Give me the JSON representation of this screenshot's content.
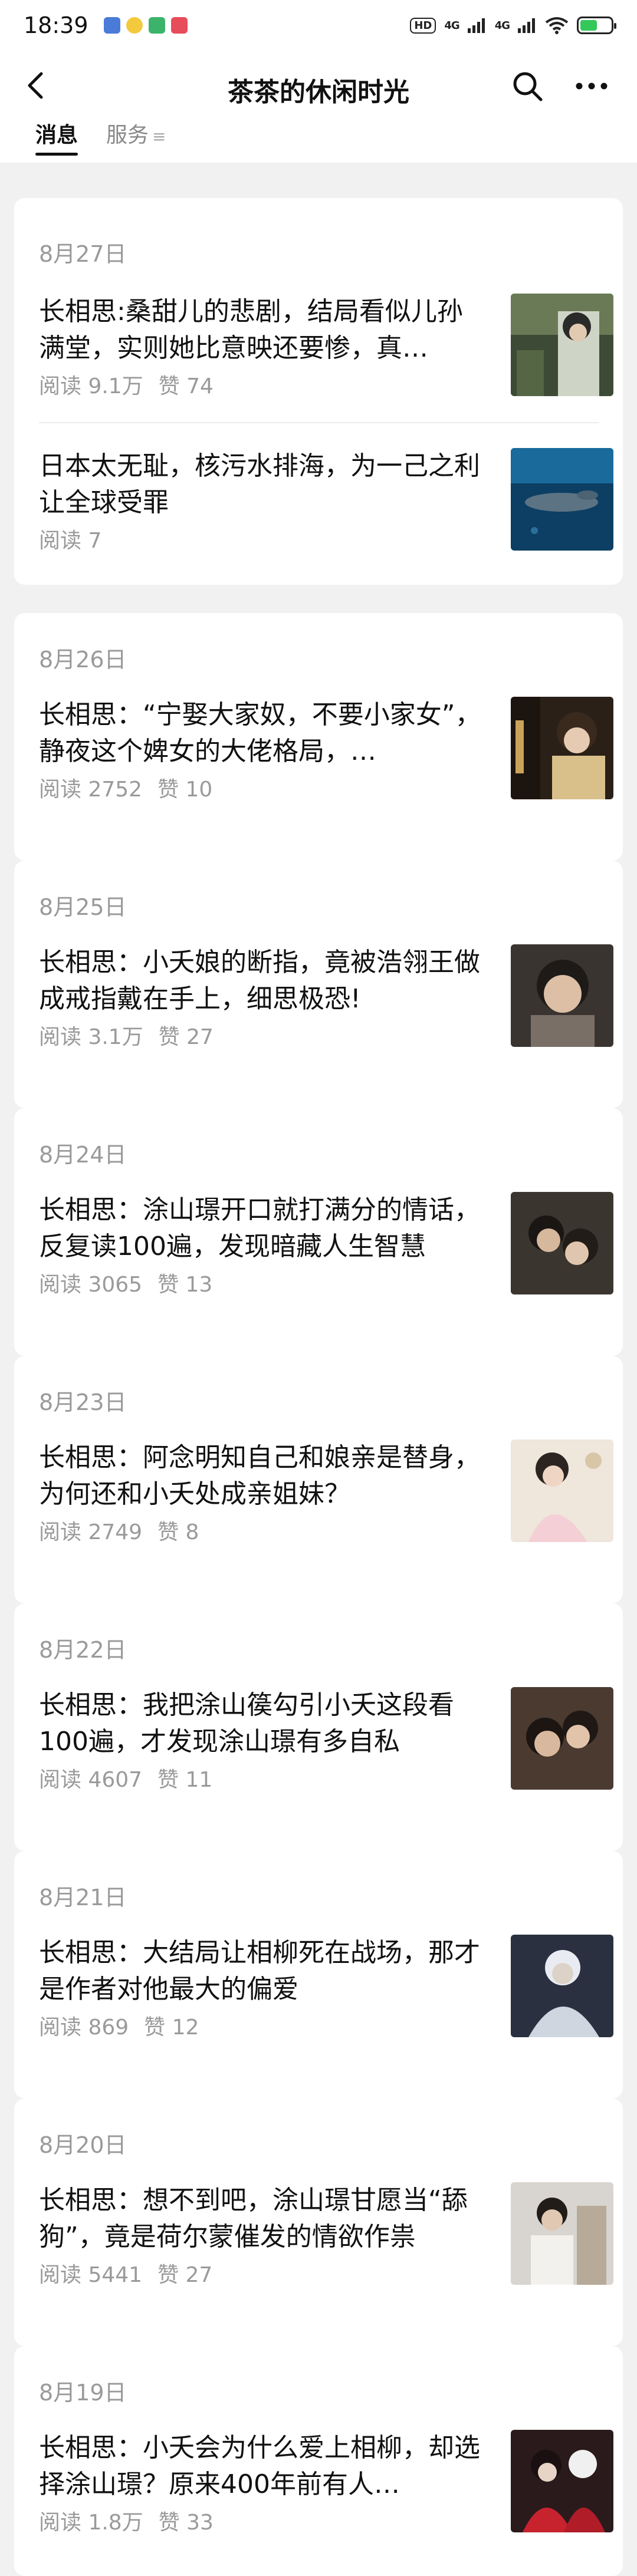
{
  "status_bar": {
    "time": "18:39",
    "hd_badge": "HD",
    "net1": "4G",
    "net2": "4G",
    "battery_level": 0.55
  },
  "header": {
    "title": "茶茶的休闲时光",
    "back_icon": "back-arrow-icon",
    "search_icon": "search-icon",
    "more_icon": "more-dots-icon"
  },
  "tabs": [
    {
      "label": "消息",
      "active": true
    },
    {
      "label": "服务",
      "active": false,
      "icon": "menu-lines-icon"
    }
  ],
  "groups": [
    {
      "date": "8月27日",
      "articles": [
        {
          "title": "长相思:桑甜儿的悲剧，结局看似儿孙满堂，实则她比意映还要惨，真…",
          "reads": "阅读 9.1万",
          "likes": "赞 74"
        },
        {
          "title": "日本太无耻，核污水排海，为一己之利让全球受罪",
          "reads": "阅读 7",
          "likes": ""
        }
      ]
    },
    {
      "date": "8月26日",
      "articles": [
        {
          "title": "长相思：“宁娶大家奴，不要小家女”，静夜这个婢女的大佬格局，…",
          "reads": "阅读 2752",
          "likes": "赞 10"
        }
      ]
    },
    {
      "date": "8月25日",
      "articles": [
        {
          "title": "长相思：小夭娘的断指，竟被浩翎王做成戒指戴在手上，细思极恐!",
          "reads": "阅读 3.1万",
          "likes": "赞 27"
        }
      ]
    },
    {
      "date": "8月24日",
      "articles": [
        {
          "title": "长相思：涂山璟开口就打满分的情话，反复读100遍，发现暗藏人生智慧",
          "reads": "阅读 3065",
          "likes": "赞 13"
        }
      ]
    },
    {
      "date": "8月23日",
      "articles": [
        {
          "title": "长相思：阿念明知自己和娘亲是替身，为何还和小夭处成亲姐妹？",
          "reads": "阅读 2749",
          "likes": "赞 8"
        }
      ]
    },
    {
      "date": "8月22日",
      "articles": [
        {
          "title": "长相思：我把涂山篌勾引小夭这段看100遍，才发现涂山璟有多自私",
          "reads": "阅读 4607",
          "likes": "赞 11"
        }
      ]
    },
    {
      "date": "8月21日",
      "articles": [
        {
          "title": "长相思：大结局让相柳死在战场，那才是作者对他最大的偏爱",
          "reads": "阅读 869",
          "likes": "赞 12"
        }
      ]
    },
    {
      "date": "8月20日",
      "articles": [
        {
          "title": "长相思：想不到吧，涂山璟甘愿当“舔狗”，竟是荷尔蒙催发的情欲作祟",
          "reads": "阅读 5441",
          "likes": "赞 27"
        }
      ]
    },
    {
      "date": "8月19日",
      "articles": [
        {
          "title": "长相思：小夭会为什么爱上相柳，却选择涂山璟？原来400年前有人…",
          "reads": "阅读 1.8万",
          "likes": "赞 33"
        }
      ]
    }
  ]
}
